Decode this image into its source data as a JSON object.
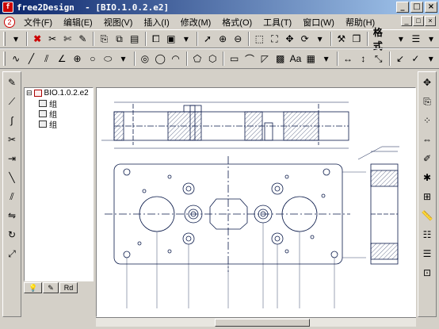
{
  "titlebar": {
    "app": "free2Design",
    "doc": "- [BIO.1.0.2.e2]"
  },
  "menu": [
    "文件(F)",
    "编辑(E)",
    "视图(V)",
    "插入(I)",
    "修改(M)",
    "格式(O)",
    "工具(T)",
    "窗口(W)",
    "帮助(H)"
  ],
  "toolbar": {
    "format_label": "格式"
  },
  "tree": {
    "root": "BIO.1.0.2.e2",
    "children": [
      "组",
      "组",
      "组"
    ]
  },
  "tabs": [
    "",
    "",
    "Rd"
  ],
  "icons": {
    "app": "app-icon",
    "close": "close-icon"
  }
}
